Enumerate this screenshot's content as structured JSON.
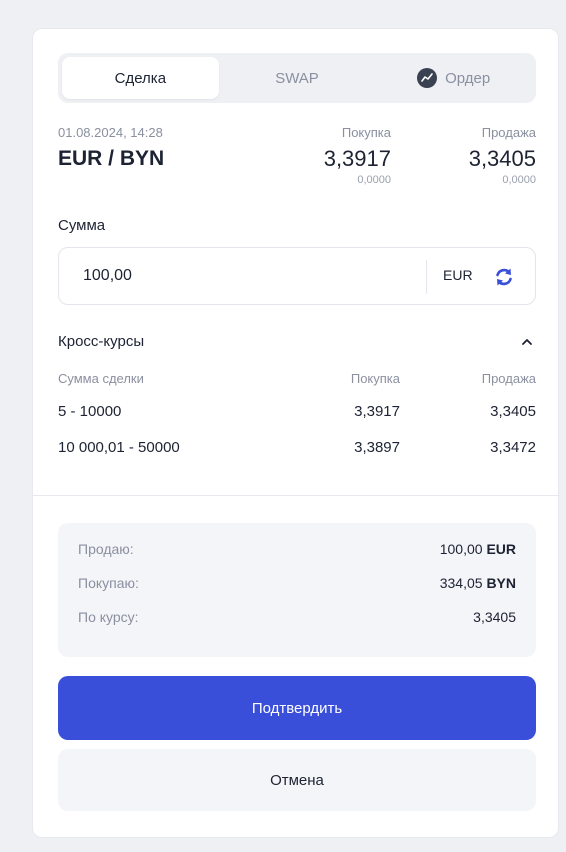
{
  "tabs": [
    {
      "label": "Сделка",
      "active": true
    },
    {
      "label": "SWAP",
      "active": false
    },
    {
      "label": "Ордер",
      "active": false,
      "icon": "trend-icon"
    }
  ],
  "pair": {
    "datetime": "01.08.2024, 14:28",
    "name": "EUR / BYN",
    "buy_label": "Покупка",
    "buy_rate": "3,3917",
    "buy_change": "0,0000",
    "sell_label": "Продажа",
    "sell_rate": "3,3405",
    "sell_change": "0,0000"
  },
  "amount": {
    "label": "Сумма",
    "value": "100,00",
    "currency": "EUR",
    "swap_icon": "refresh-icon"
  },
  "cross": {
    "title": "Кросс-курсы",
    "toggle_icon": "chevron-up-icon",
    "headers": [
      "Сумма сделки",
      "Покупка",
      "Продажа"
    ],
    "rows": [
      [
        "5 - 10000",
        "3,3917",
        "3,3405"
      ],
      [
        "10 000,01 - 50000",
        "3,3897",
        "3,3472"
      ]
    ]
  },
  "summary": {
    "sell_label": "Продаю:",
    "sell_amount": "100,00",
    "sell_currency": "EUR",
    "buy_label": "Покупаю:",
    "buy_amount": "334,05",
    "buy_currency": "BYN",
    "rate_label": "По курсу:",
    "rate_value": "3,3405"
  },
  "actions": {
    "confirm": "Подтвердить",
    "cancel": "Отмена"
  },
  "colors": {
    "accent": "#3a4fd9",
    "muted_text": "#8a90a0",
    "surface": "#f4f5f8"
  }
}
